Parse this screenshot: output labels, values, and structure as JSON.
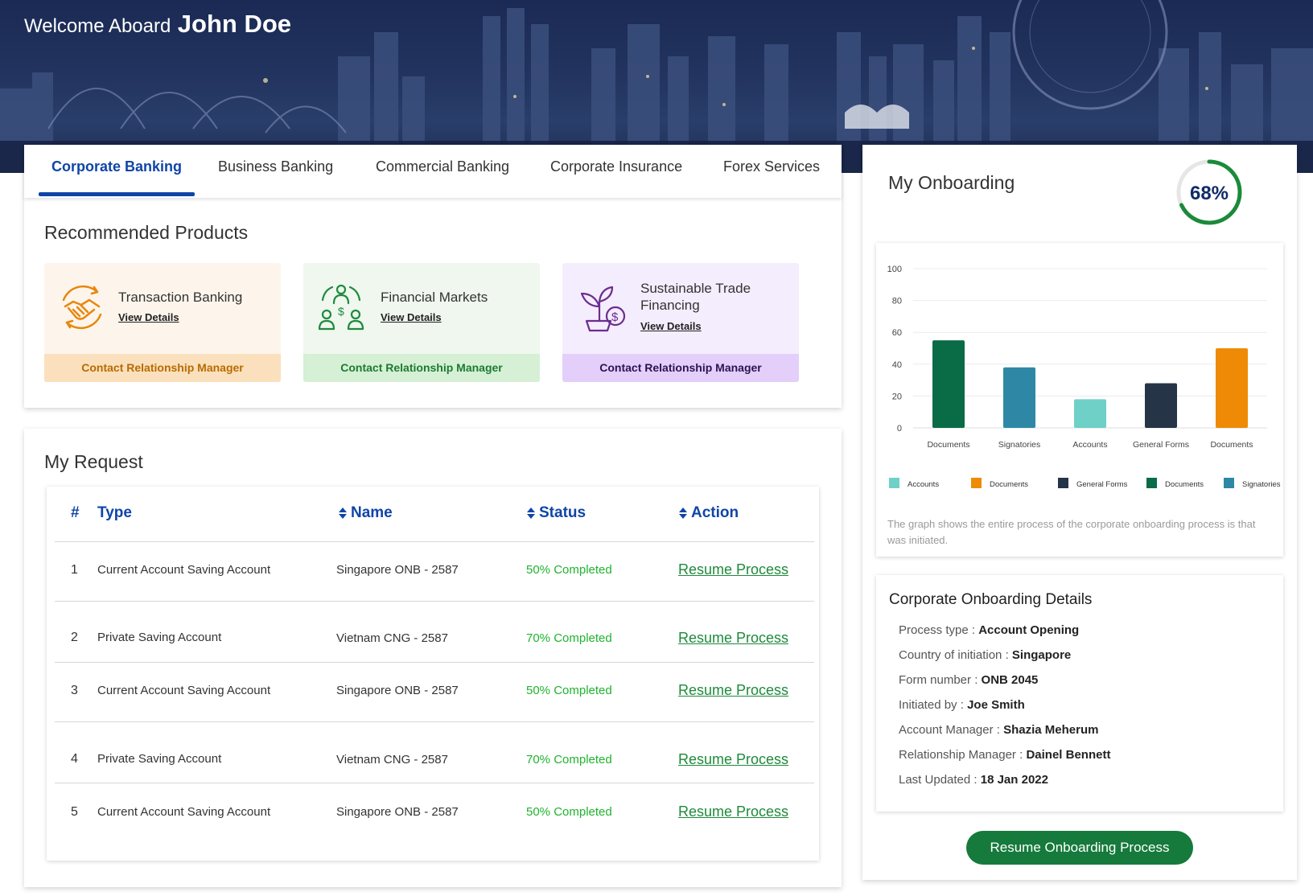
{
  "header": {
    "welcome": "Welcome Aboard",
    "user_name": "John Doe"
  },
  "tabs": [
    {
      "label": "Corporate Banking",
      "active": true
    },
    {
      "label": "Business Banking",
      "active": false
    },
    {
      "label": "Commercial Banking",
      "active": false
    },
    {
      "label": "Corporate Insurance",
      "active": false
    },
    {
      "label": "Forex Services",
      "active": false
    }
  ],
  "recommended": {
    "title": "Recommended Products",
    "products": [
      {
        "name": "Transaction Banking",
        "link": "View Details",
        "cta": "Contact Relationship Manager",
        "icon": "handshake-icon",
        "bg": "#fdf5ec",
        "footer_bg": "#fae0bd",
        "footer_color": "#b86b00",
        "icon_color": "#e8870c"
      },
      {
        "name": "Financial Markets",
        "link": "View Details",
        "cta": "Contact Relationship Manager",
        "icon": "investors-icon",
        "bg": "#eff7ee",
        "footer_bg": "#d5f0d5",
        "footer_color": "#1e7a32",
        "icon_color": "#1f8a3e"
      },
      {
        "name": "Sustainable Trade Financing",
        "link": "View Details",
        "cta": "Contact Relationship Manager",
        "icon": "plant-money-icon",
        "bg": "#f4edfd",
        "footer_bg": "#e3cffa",
        "footer_color": "#2b1450",
        "icon_color": "#6b2d8f"
      }
    ]
  },
  "requests": {
    "title": "My Request",
    "columns": {
      "num": "#",
      "type": "Type",
      "name": "Name",
      "status": "Status",
      "action": "Action"
    },
    "rows": [
      {
        "num": "1",
        "type": "Current Account Saving Account",
        "name": "Singapore ONB -  2587",
        "status": "50% Completed",
        "action": "Resume Process"
      },
      {
        "num": "2",
        "type": "Private Saving Account",
        "name": "Vietnam CNG -  2587",
        "status": "70% Completed",
        "action": "Resume Process"
      },
      {
        "num": "3",
        "type": "Current Account Saving Account",
        "name": "Singapore ONB -  2587",
        "status": "50% Completed",
        "action": "Resume Process"
      },
      {
        "num": "4",
        "type": "Private Saving Account",
        "name": "Vietnam CNG -  2587",
        "status": "70% Completed",
        "action": "Resume Process"
      },
      {
        "num": "5",
        "type": "Current Account Saving Account",
        "name": "Singapore ONB -  2587",
        "status": "50% Completed",
        "action": "Resume Process"
      }
    ]
  },
  "onboarding": {
    "title": "My Onboarding",
    "progress_label": "68%",
    "progress": 0.68,
    "note": "The graph shows the entire process of the corporate onboarding process is that was initiated.",
    "details_title": "Corporate Onboarding Details",
    "details": [
      {
        "label": "Process type : ",
        "value": "Account Opening"
      },
      {
        "label": "Country of initiation : ",
        "value": "Singapore"
      },
      {
        "label": "Form number : ",
        "value": "ONB 2045"
      },
      {
        "label": "Initiated by : ",
        "value": "Joe Smith"
      },
      {
        "label": "Account Manager : ",
        "value": "Shazia Meherum"
      },
      {
        "label": "Relationship Manager : ",
        "value": "Dainel Bennett"
      },
      {
        "label": "Last Updated : ",
        "value": "18 Jan 2022"
      }
    ],
    "button": "Resume Onboarding Process"
  },
  "chart_data": {
    "type": "bar",
    "categories": [
      "Documents",
      "Signatories",
      "Accounts",
      "General Forms",
      "Documents"
    ],
    "values": [
      55,
      38,
      18,
      28,
      50
    ],
    "colors": [
      "#0a6b47",
      "#2e88a5",
      "#6fd0c8",
      "#263448",
      "#ef8a06"
    ],
    "ylim": [
      0,
      100
    ],
    "yticks": [
      0,
      20,
      40,
      60,
      80,
      100
    ],
    "grid": true,
    "legend_position": "bottom",
    "legend": [
      {
        "name": "Accounts",
        "color": "#6fd0c8"
      },
      {
        "name": "Documents",
        "color": "#ef8a06"
      },
      {
        "name": "General Forms",
        "color": "#263448"
      },
      {
        "name": "Documents",
        "color": "#0a6b47"
      },
      {
        "name": "Signatories",
        "color": "#2e88a5"
      }
    ]
  }
}
